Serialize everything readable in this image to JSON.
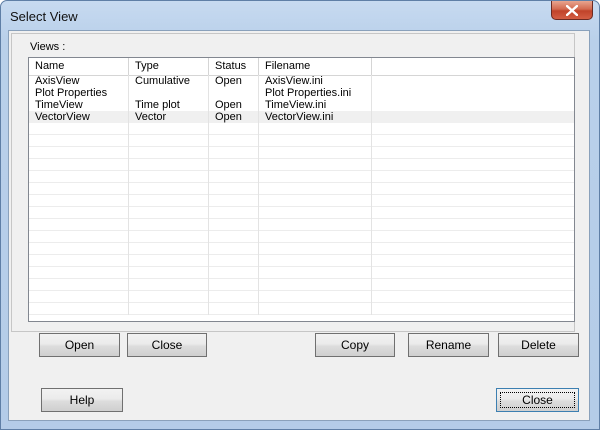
{
  "window": {
    "title": "Select View"
  },
  "views_group": {
    "label": "Views :"
  },
  "list": {
    "columns": [
      "Name",
      "Type",
      "Status",
      "Filename",
      ""
    ],
    "rows": [
      [
        "AxisView",
        "Cumulative",
        "Open",
        "AxisView.ini"
      ],
      [
        "Plot Properties",
        "",
        "",
        "Plot Properties.ini"
      ],
      [
        "TimeView",
        "Time plot",
        "Open",
        "TimeView.ini"
      ],
      [
        "VectorView",
        "Vector",
        "Open",
        "VectorView.ini"
      ]
    ],
    "selected_row": 3
  },
  "buttons": {
    "open": "Open",
    "close_view": "Close",
    "copy": "Copy",
    "rename": "Rename",
    "delete": "Delete",
    "help": "Help",
    "close_dialog": "Close"
  },
  "icons": {
    "titlebar_close": "close-icon"
  },
  "colors": {
    "titlebar_close_bg": "#c0432a",
    "dialog_bg": "#f0f0f0",
    "frame": "#b9d0ea"
  }
}
